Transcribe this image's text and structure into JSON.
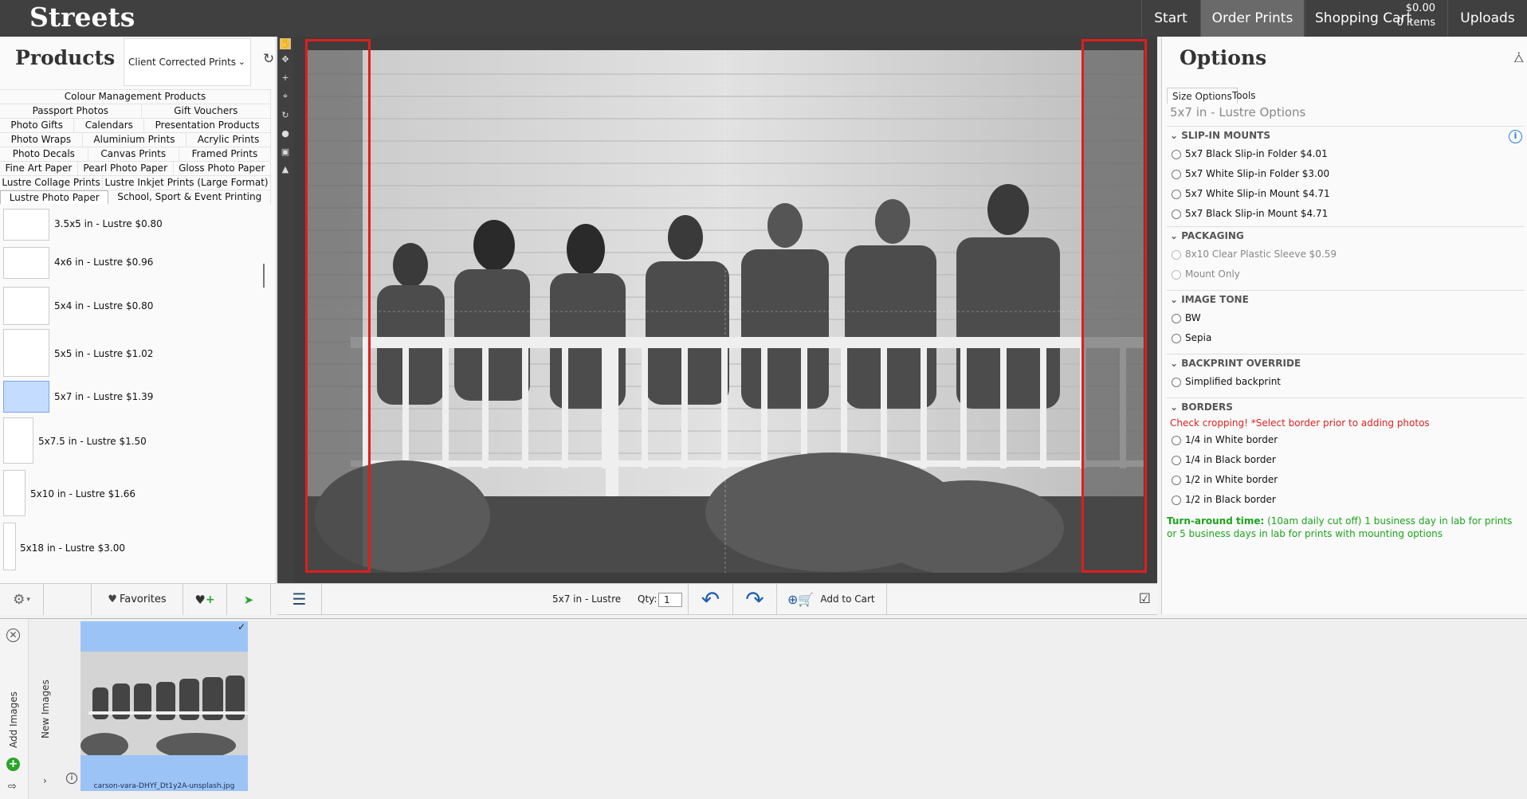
{
  "app": {
    "brand": "Streets"
  },
  "nav": {
    "start": "Start",
    "order_prints": "Order Prints",
    "shopping_cart": "Shopping Cart",
    "cart_price": "$0.00",
    "cart_items": "0 items",
    "uploads": "Uploads"
  },
  "products": {
    "title": "Products",
    "category_select": "Client Corrected Prints",
    "tab_rows": [
      [
        "Colour Management Products"
      ],
      [
        "Passport Photos",
        "Gift Vouchers"
      ],
      [
        "Photo Gifts",
        "Calendars",
        "Presentation Products"
      ],
      [
        "Photo Wraps",
        "Aluminium Prints",
        "Acrylic Prints"
      ],
      [
        "Photo Decals",
        "Canvas Prints",
        "Framed Prints"
      ],
      [
        "Fine Art Paper",
        "Pearl Photo Paper",
        "Gloss Photo Paper"
      ],
      [
        "Lustre Collage Prints",
        "Lustre Inkjet Prints (Large Format)"
      ],
      [
        "Lustre Photo Paper",
        "School, Sport & Event Printing"
      ]
    ],
    "active_tab": "Lustre Photo Paper",
    "sizes": [
      {
        "label": "3.5x5 in - Lustre $0.80",
        "selected": false
      },
      {
        "label": "4x6 in - Lustre $0.96",
        "selected": false
      },
      {
        "label": "5x4 in - Lustre $0.80",
        "selected": false
      },
      {
        "label": "5x5 in - Lustre $1.02",
        "selected": false
      },
      {
        "label": "5x7 in - Lustre $1.39",
        "selected": true
      },
      {
        "label": "5x7.5 in - Lustre $1.50",
        "selected": false
      },
      {
        "label": "5x10 in - Lustre $1.66",
        "selected": false
      },
      {
        "label": "5x18 in - Lustre $3.00",
        "selected": false
      }
    ],
    "footer": {
      "settings_icon": "gear-icon",
      "favorites": "Favorites",
      "add_favorite_icon": "heart-plus-icon",
      "favorites_arrow_icon": "heart-arrow-icon"
    }
  },
  "canvas": {
    "product_label": "5x7 in - Lustre",
    "qty_label": "Qty:",
    "qty_value": "1",
    "undo_icon": "undo-arrow-icon",
    "redo_icon": "redo-arrow-icon",
    "add_to_cart": "Add to Cart",
    "layers_icon": "layers-icon",
    "checkbox_icon": "checkbox-icon"
  },
  "options": {
    "title": "Options",
    "tabs": [
      "Size Options",
      "Tools"
    ],
    "active_tab": "Size Options",
    "subtitle": "5x7 in - Lustre Options",
    "sections": {
      "slip_in": {
        "title": "SLIP-IN MOUNTS",
        "items": [
          "5x7 Black Slip-in Folder $4.01",
          "5x7 White Slip-in Folder $3.00",
          "5x7 White Slip-in Mount $4.71",
          "5x7 Black Slip-in Mount $4.71"
        ]
      },
      "packaging": {
        "title": "PACKAGING",
        "items": [
          "8x10 Clear Plastic Sleeve $0.59",
          "Mount Only"
        ]
      },
      "tone": {
        "title": "IMAGE TONE",
        "items": [
          "BW",
          "Sepia"
        ]
      },
      "backprint": {
        "title": "BACKPRINT OVERRIDE",
        "items": [
          "Simplified backprint"
        ]
      },
      "borders": {
        "title": "BORDERS",
        "warning": "Check cropping! *Select border prior to adding photos",
        "items": [
          "1/4 in White border",
          "1/4 in Black border",
          "1/2 in White border",
          "1/2 in Black border"
        ]
      }
    },
    "turnaround_label": "Turn-around time:",
    "turnaround_text": "(10am daily cut off) 1 business day in lab for prints or 5 business days in lab for prints with mounting options"
  },
  "tray": {
    "add_images": "Add Images",
    "new_images": "New Images",
    "thumbnail_filename": "carson-vara-DHYf_Dt1y2A-unsplash.jpg"
  },
  "colors": {
    "topbar": "#404040",
    "active_nav": "#6a6a6a",
    "crop_frame": "#e01e1e",
    "turnaround": "#1ca41c",
    "warning": "#d22222",
    "selected_thumb": "#c3dcff"
  }
}
